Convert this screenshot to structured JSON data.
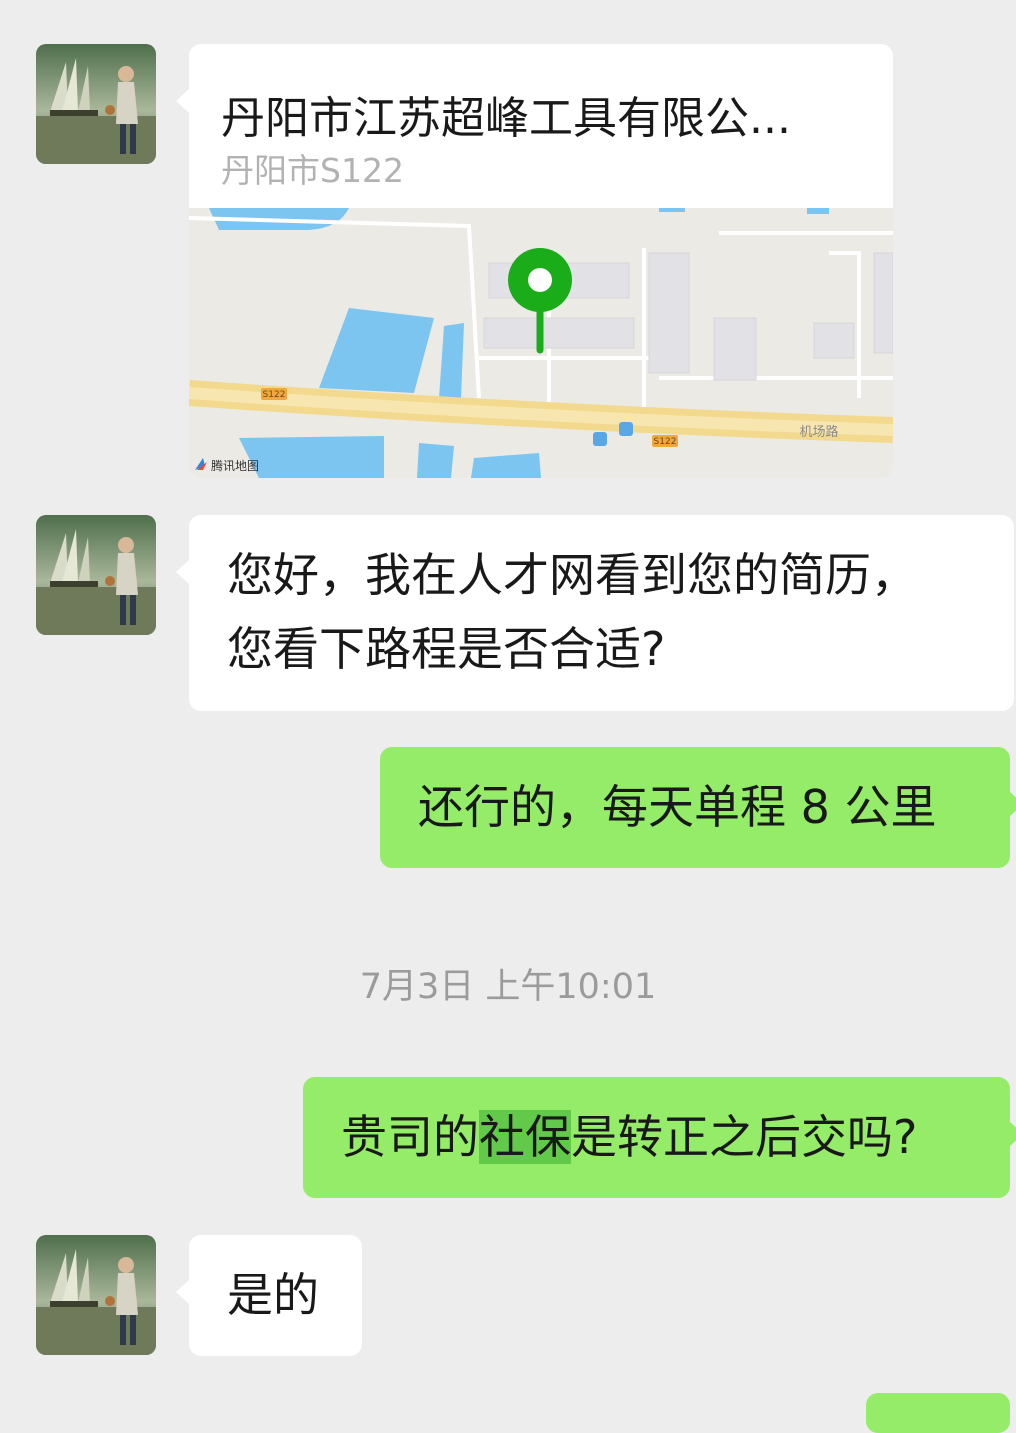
{
  "messages": {
    "location": {
      "title": "丹阳市江苏超峰工具有限公...",
      "subtitle": "丹阳市S122",
      "map_labels": {
        "road_s122_a": "S122",
        "road_s122_b": "S122",
        "road_airport": "机场路",
        "provider": "腾讯地图"
      },
      "pin_color": "#1aad19"
    },
    "m1": {
      "line1": "您好，我在人才网看到您的简历，",
      "line2": "您看下路程是否合适?"
    },
    "m2": {
      "text": "还行的，每天单程 8 公里"
    },
    "timestamp": "7月3日 上午10:01",
    "m3": {
      "part1": "贵司的",
      "highlight": "社保",
      "part2": "是转正之后交吗?"
    },
    "m4": {
      "text": "是的"
    }
  },
  "colors": {
    "background": "#ededed",
    "incoming_bubble": "#ffffff",
    "outgoing_bubble": "#95ec69",
    "selection_highlight": "#63c94b"
  }
}
